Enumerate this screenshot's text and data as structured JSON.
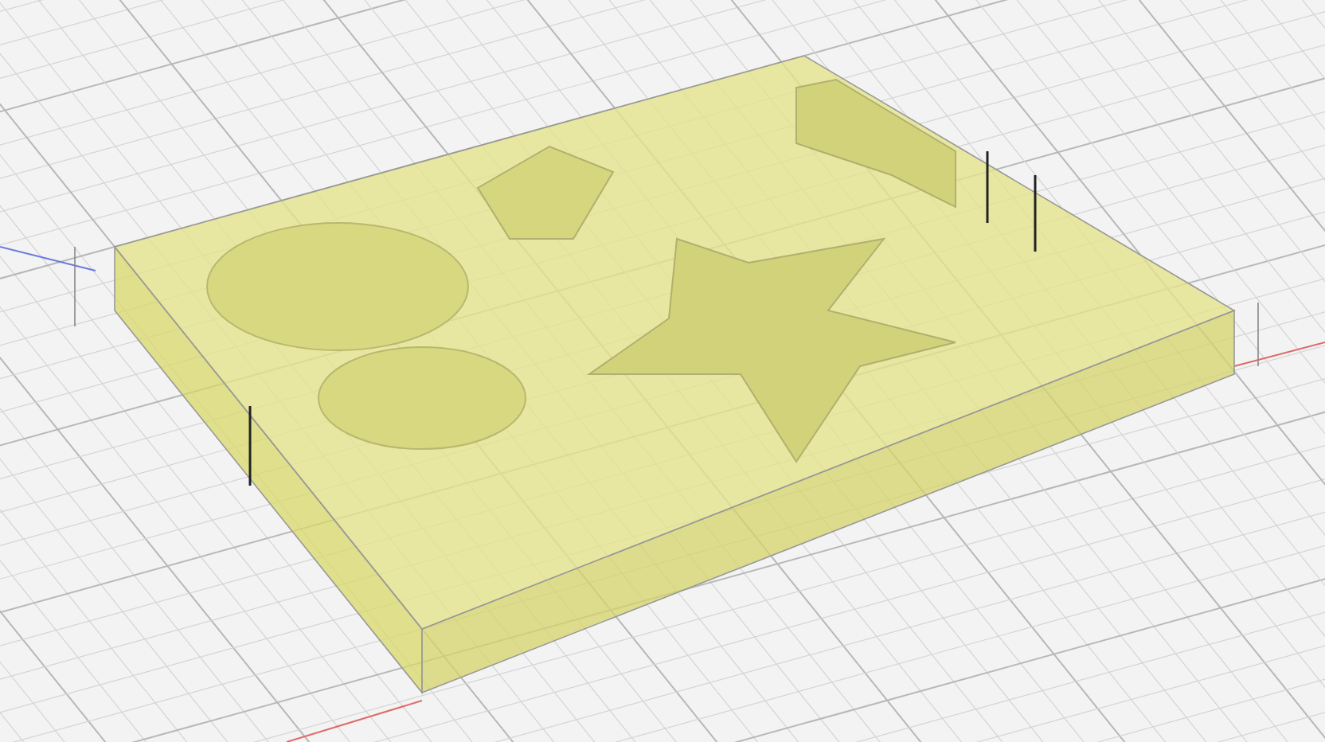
{
  "scene": {
    "kind": "viewport-3d"
  }
}
